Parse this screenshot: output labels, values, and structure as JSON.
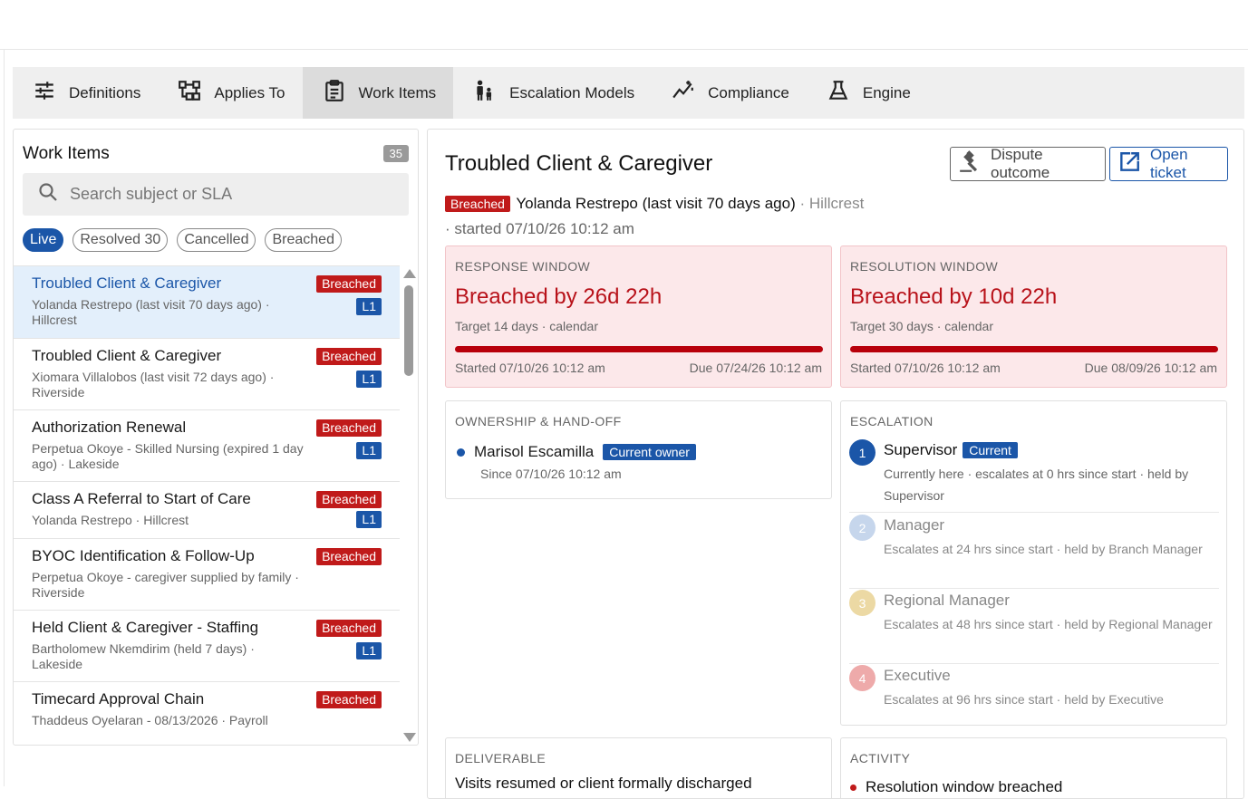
{
  "tabs": [
    {
      "label": "Definitions",
      "icon": "sliders-icon"
    },
    {
      "label": "Applies To",
      "icon": "hierarchy-icon"
    },
    {
      "label": "Work Items",
      "icon": "clipboard-icon"
    },
    {
      "label": "Escalation Models",
      "icon": "escalation-people-icon"
    },
    {
      "label": "Compliance",
      "icon": "trend-line-icon"
    },
    {
      "label": "Engine",
      "icon": "flask-icon"
    }
  ],
  "active_tab": "Work Items",
  "list_panel": {
    "title": "Work Items",
    "count": "35",
    "search_placeholder": "Search subject or SLA",
    "filters": [
      "Live",
      "Resolved 30",
      "Cancelled",
      "Breached"
    ],
    "active_filter": "Live",
    "items": [
      {
        "subject": "Troubled Client & Caregiver",
        "meta": "Yolanda Restrepo (last visit 70 days ago) · Hillcrest",
        "status": "Breached",
        "level": "L1"
      },
      {
        "subject": "Troubled Client & Caregiver",
        "meta": "Xiomara Villalobos (last visit 72 days ago) · Riverside",
        "status": "Breached",
        "level": "L1"
      },
      {
        "subject": "Authorization Renewal",
        "meta": "Perpetua Okoye - Skilled Nursing (expired 1 day ago) · Lakeside",
        "status": "Breached",
        "level": "L1"
      },
      {
        "subject": "Class A Referral to Start of Care",
        "meta": "Yolanda Restrepo · Hillcrest",
        "status": "Breached",
        "level": "L1"
      },
      {
        "subject": "BYOC Identification & Follow-Up",
        "meta": "Perpetua Okoye - caregiver supplied by family · Riverside",
        "status": "Breached",
        "level": ""
      },
      {
        "subject": "Held Client & Caregiver - Staffing",
        "meta": "Bartholomew Nkemdirim (held 7 days) · Lakeside",
        "status": "Breached",
        "level": "L1"
      },
      {
        "subject": "Timecard Approval Chain",
        "meta": "Thaddeus Oyelaran - 08/13/2026 · Payroll",
        "status": "Breached",
        "level": ""
      }
    ]
  },
  "detail": {
    "title": "Troubled Client & Caregiver",
    "dispute_label": "Dispute outcome",
    "open_ticket_label": "Open ticket",
    "status": "Breached",
    "person": "Yolanda Restrepo (last visit 70 days ago)",
    "location": "· Hillcrest",
    "started": "· started 07/10/26 10:12 am",
    "response": {
      "label": "RESPONSE WINDOW",
      "headline": "Breached by 26d 22h",
      "target": "Target 14 days · calendar",
      "progress": 1.0,
      "started": "Started 07/10/26 10:12 am",
      "due": "Due 07/24/26 10:12 am"
    },
    "resolution": {
      "label": "RESOLUTION WINDOW",
      "headline": "Breached by 10d 22h",
      "target": "Target 30 days · calendar",
      "progress": 1.0,
      "started": "Started 07/10/26 10:12 am",
      "due": "Due 08/09/26 10:12 am"
    },
    "ownership": {
      "label": "OWNERSHIP & HAND-OFF",
      "owner": "Marisol Escamilla",
      "owner_tag": "Current owner",
      "since": "Since 07/10/26 10:12 am"
    },
    "escalation": {
      "label": "ESCALATION",
      "steps": [
        {
          "num": "1",
          "name": "Supervisor",
          "tag": "Current",
          "desc": "Currently here · escalates at 0 hrs since start · held by Supervisor",
          "color": "#1b56a8"
        },
        {
          "num": "2",
          "name": "Manager",
          "tag": "",
          "desc": "Escalates at 24 hrs since start · held by Branch Manager",
          "color": "#c6d6ec"
        },
        {
          "num": "3",
          "name": "Regional Manager",
          "tag": "",
          "desc": "Escalates at 48 hrs since start · held by Regional Manager",
          "color": "#ecd9a4"
        },
        {
          "num": "4",
          "name": "Executive",
          "tag": "",
          "desc": "Escalates at 96 hrs since start · held by Executive",
          "color": "#eeaaaa"
        }
      ]
    },
    "deliverable": {
      "label": "DELIVERABLE",
      "text": "Visits resumed or client formally discharged"
    },
    "activity": {
      "label": "ACTIVITY",
      "first": "Resolution window breached"
    }
  },
  "colors": {
    "accent": "#1b56a8",
    "breach": "#c01a1a",
    "breach_bg": "#fce8ea"
  }
}
